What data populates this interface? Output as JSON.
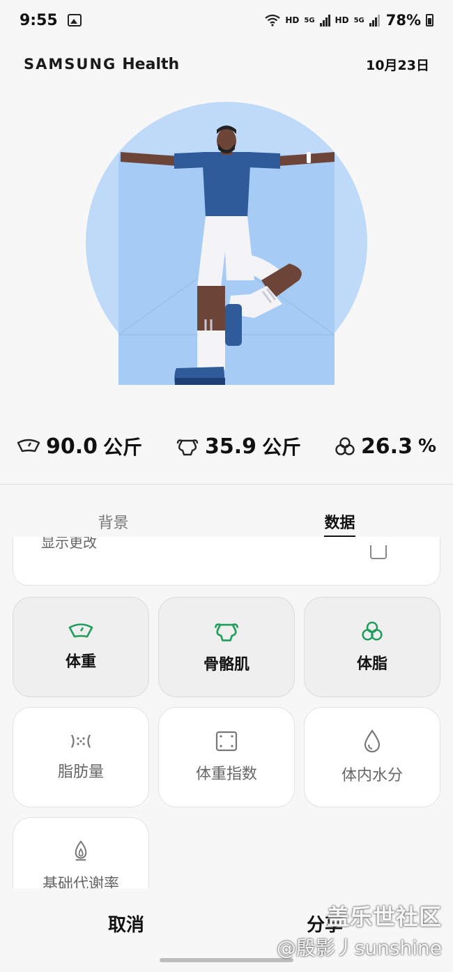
{
  "status_bar": {
    "time": "9:55",
    "hd1": "HD",
    "net1": "5G",
    "hd2": "HD",
    "net2": "5G",
    "battery": "78%"
  },
  "header": {
    "brand": "SAMSUNG",
    "brand_suffix": "Health",
    "date": "10月23日"
  },
  "metrics": [
    {
      "icon": "scale-icon",
      "value": "90.0",
      "unit": "公斤"
    },
    {
      "icon": "muscle-icon",
      "value": "35.9",
      "unit": "公斤"
    },
    {
      "icon": "body-fat-icon",
      "value": "26.3",
      "unit": "%"
    }
  ],
  "tabs": [
    {
      "label": "背景",
      "active": false
    },
    {
      "label": "数据",
      "active": true
    }
  ],
  "partial_card": {
    "label": "显示更改"
  },
  "tiles": [
    {
      "label": "体重",
      "icon": "scale-icon",
      "selected": true
    },
    {
      "label": "骨骼肌",
      "icon": "muscle-icon",
      "selected": true
    },
    {
      "label": "体脂",
      "icon": "body-fat-icon",
      "selected": true
    },
    {
      "label": "脂肪量",
      "icon": "fat-mass-icon",
      "selected": false
    },
    {
      "label": "体重指数",
      "icon": "bmi-icon",
      "selected": false
    },
    {
      "label": "体内水分",
      "icon": "water-drop-icon",
      "selected": false
    },
    {
      "label": "基础代谢率",
      "icon": "flame-icon",
      "selected": false
    }
  ],
  "bottom_bar": {
    "cancel": "取消",
    "share": "分享"
  },
  "watermark": {
    "line1": "盖乐世社区",
    "line2": "@殷影丿sunshine"
  },
  "colors": {
    "accent_green": "#1e9e5a",
    "circle_blue": "#a6ccf5",
    "shirt_blue": "#2f5b9a"
  }
}
